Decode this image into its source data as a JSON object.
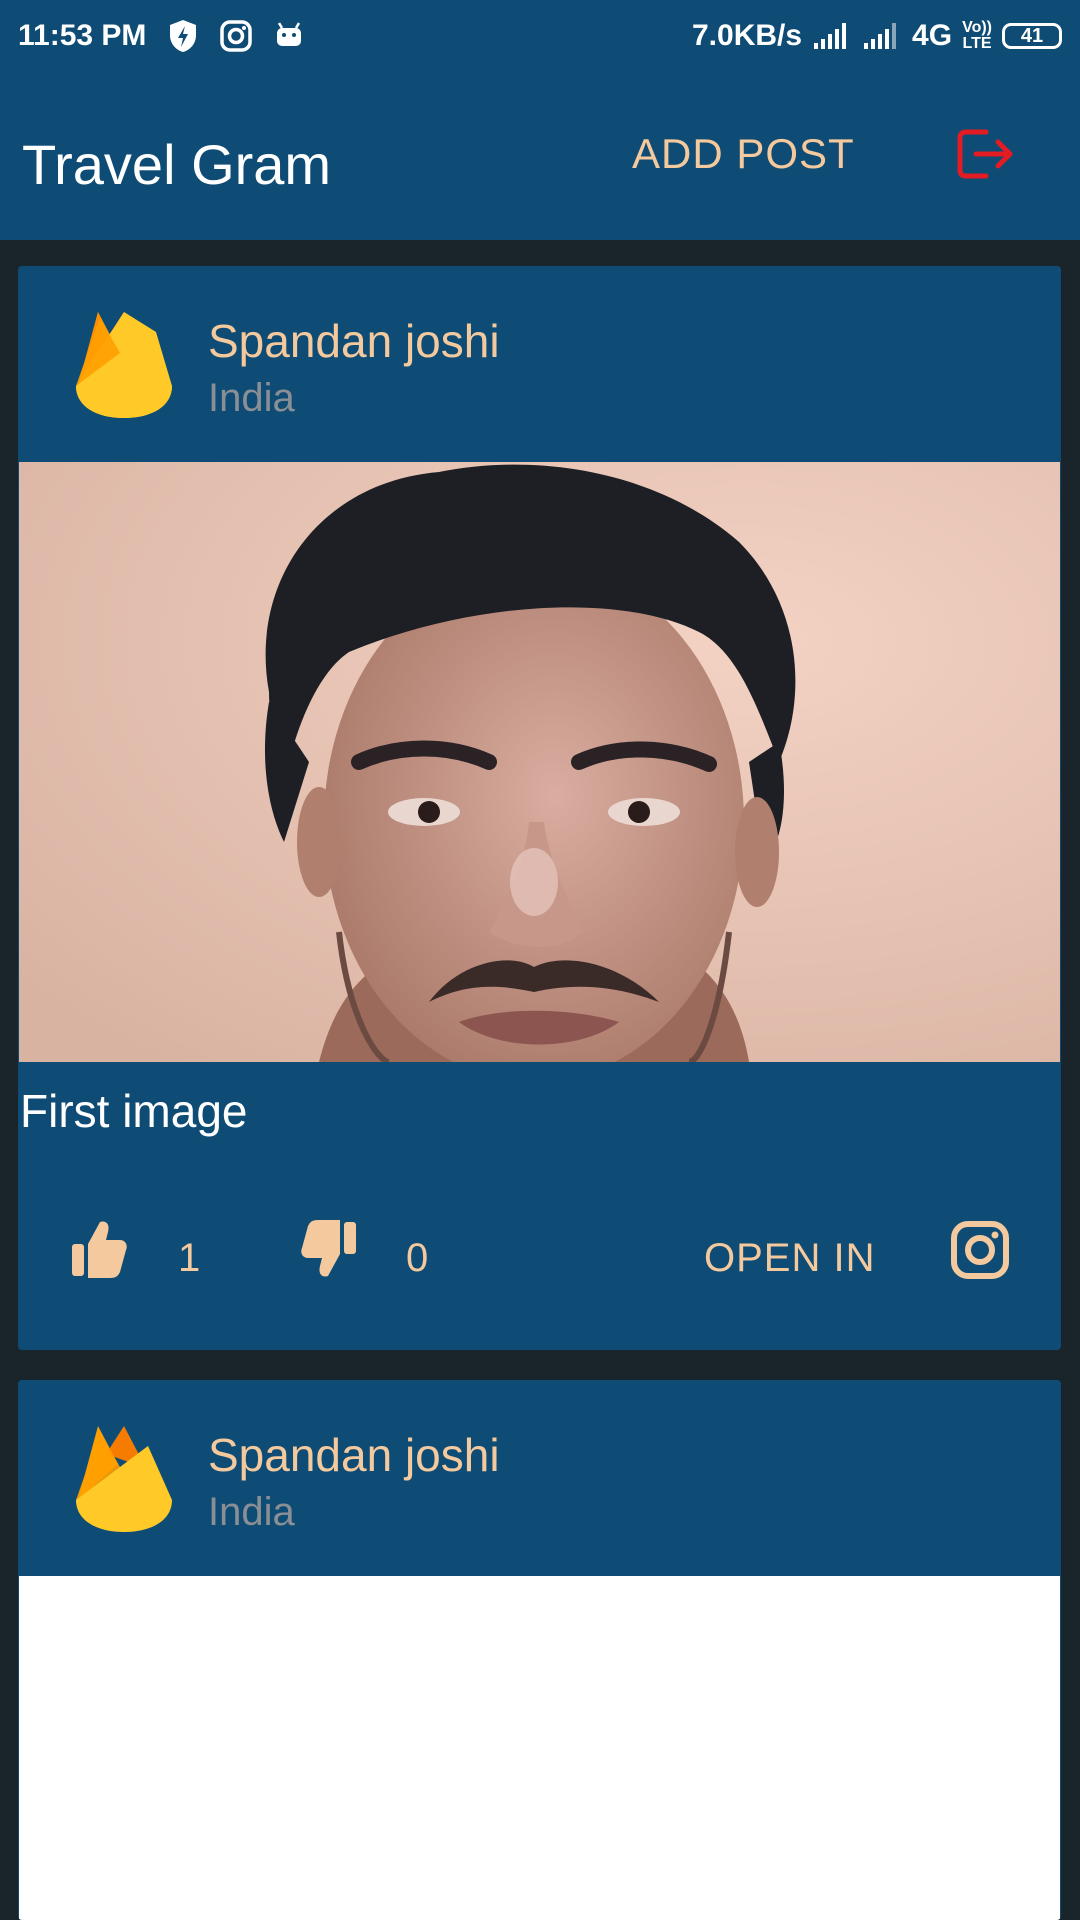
{
  "status_bar": {
    "time": "11:53 PM",
    "net_speed": "7.0KB/s",
    "network": "4G",
    "volte_top": "Vo))",
    "volte_bottom": "LTE",
    "battery": "41",
    "icons": [
      "shield-bolt-icon",
      "instagram-icon",
      "android-icon",
      "signal-icon",
      "signal-icon",
      "battery-icon"
    ]
  },
  "app_bar": {
    "title": "Travel Gram",
    "add_post_label": "ADD POST",
    "logout_icon": "logout-icon",
    "colors": {
      "bar": "#0f4c75",
      "accent": "#f3c99d",
      "logout": "#e31b23"
    }
  },
  "posts": [
    {
      "author": "Spandan joshi",
      "location": "India",
      "image": "selfie photo",
      "caption": "First image",
      "likes": "1",
      "dislikes": "0",
      "open_in_label": "OPEN IN"
    },
    {
      "author": "Spandan joshi",
      "location": "India"
    }
  ]
}
